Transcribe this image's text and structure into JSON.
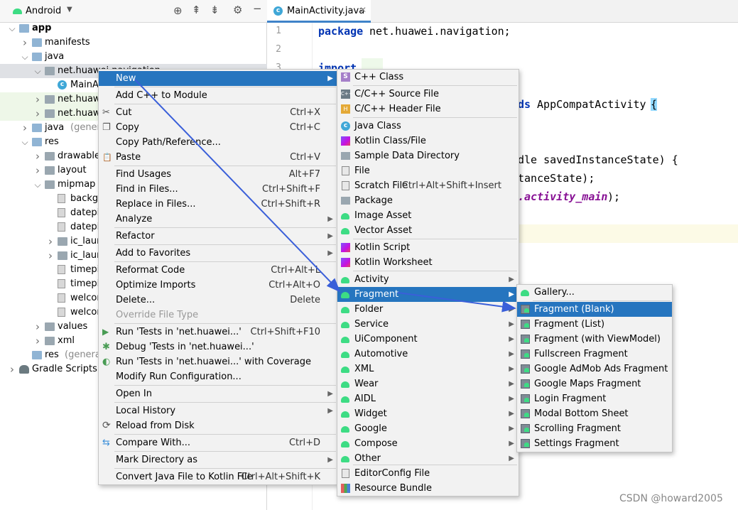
{
  "project_pane": {
    "view_selector": "Android",
    "tree": [
      {
        "label": "app",
        "bold": true
      },
      {
        "label": "manifests"
      },
      {
        "label": "java"
      },
      {
        "label": "net.huawei.navigation"
      },
      {
        "label": "MainA"
      },
      {
        "label": "net.huawe"
      },
      {
        "label": "net.huawe"
      },
      {
        "label": "java",
        "suffix": "(genera"
      },
      {
        "label": "res"
      },
      {
        "label": "drawable"
      },
      {
        "label": "layout"
      },
      {
        "label": "mipmap"
      },
      {
        "label": "backg"
      },
      {
        "label": "datepi"
      },
      {
        "label": "datepi"
      },
      {
        "label": "ic_laun"
      },
      {
        "label": "ic_laun"
      },
      {
        "label": "timepi"
      },
      {
        "label": "timepi"
      },
      {
        "label": "welcor"
      },
      {
        "label": "welcor"
      },
      {
        "label": "values"
      },
      {
        "label": "xml"
      },
      {
        "label": "res",
        "suffix": "(generat"
      },
      {
        "label": "Gradle Scripts"
      }
    ]
  },
  "editor": {
    "tab": "MainActivity.java",
    "line_numbers": [
      "1",
      "2",
      "3"
    ],
    "code": {
      "l1_kw": "package",
      "l1_rest": " net.huawei.navigation;",
      "l3_kw": "import",
      "l5_kw": "ds",
      "l5_rest": " AppCompatActivity ",
      "l5_brace": "{",
      "l8": "dle savedInstanceState) {",
      "l9": "tanceState);",
      "l10_italic": ".activity_main",
      "l10_rest": ");"
    }
  },
  "context_menu": [
    {
      "label": "New",
      "sub": true,
      "selected": true
    },
    {
      "label": "Add C++ to Module"
    },
    {
      "label": "Cut",
      "shortcut": "Ctrl+X",
      "icon": "cut-icon"
    },
    {
      "label": "Copy",
      "shortcut": "Ctrl+C",
      "icon": "copy-icon"
    },
    {
      "label": "Copy Path/Reference..."
    },
    {
      "label": "Paste",
      "shortcut": "Ctrl+V",
      "icon": "paste-icon"
    },
    {
      "label": "Find Usages",
      "shortcut": "Alt+F7"
    },
    {
      "label": "Find in Files...",
      "shortcut": "Ctrl+Shift+F"
    },
    {
      "label": "Replace in Files...",
      "shortcut": "Ctrl+Shift+R"
    },
    {
      "label": "Analyze",
      "sub": true
    },
    {
      "label": "Refactor",
      "sub": true
    },
    {
      "label": "Add to Favorites",
      "sub": true
    },
    {
      "label": "Reformat Code",
      "shortcut": "Ctrl+Alt+L"
    },
    {
      "label": "Optimize Imports",
      "shortcut": "Ctrl+Alt+O"
    },
    {
      "label": "Delete...",
      "shortcut": "Delete"
    },
    {
      "label": "Override File Type",
      "disabled": true
    },
    {
      "label": "Run 'Tests in 'net.huawei...'",
      "shortcut": "Ctrl+Shift+F10",
      "icon": "run-icon"
    },
    {
      "label": "Debug 'Tests in 'net.huawei...'",
      "icon": "debug-icon"
    },
    {
      "label": "Run 'Tests in 'net.huawei...' with Coverage",
      "icon": "coverage-icon"
    },
    {
      "label": "Modify Run Configuration..."
    },
    {
      "label": "Open In",
      "sub": true
    },
    {
      "label": "Local History",
      "sub": true
    },
    {
      "label": "Reload from Disk",
      "icon": "reload-icon"
    },
    {
      "label": "Compare With...",
      "shortcut": "Ctrl+D",
      "icon": "compare-icon"
    },
    {
      "label": "Mark Directory as",
      "sub": true
    },
    {
      "label": "Convert Java File to Kotlin File",
      "shortcut": "Ctrl+Alt+Shift+K"
    }
  ],
  "new_menu": [
    {
      "label": "C++ Class",
      "icon": "cpp-class-icon"
    },
    {
      "label": "C/C++ Source File",
      "icon": "cpp-source-icon"
    },
    {
      "label": "C/C++ Header File",
      "icon": "cpp-header-icon"
    },
    {
      "label": "Java Class",
      "icon": "java-class-icon"
    },
    {
      "label": "Kotlin Class/File",
      "icon": "kotlin-icon"
    },
    {
      "label": "Sample Data Directory",
      "icon": "folder-icon"
    },
    {
      "label": "File",
      "icon": "file-icon"
    },
    {
      "label": "Scratch File",
      "shortcut": "Ctrl+Alt+Shift+Insert",
      "icon": "scratch-icon"
    },
    {
      "label": "Package",
      "icon": "package-icon"
    },
    {
      "label": "Image Asset",
      "icon": "android-icon"
    },
    {
      "label": "Vector Asset",
      "icon": "android-icon"
    },
    {
      "label": "Kotlin Script",
      "icon": "kotlin-script-icon"
    },
    {
      "label": "Kotlin Worksheet",
      "icon": "kotlin-worksheet-icon"
    },
    {
      "label": "Activity",
      "sub": true,
      "icon": "android-icon"
    },
    {
      "label": "Fragment",
      "sub": true,
      "selected": true,
      "icon": "android-icon"
    },
    {
      "label": "Folder",
      "sub": true,
      "icon": "android-icon"
    },
    {
      "label": "Service",
      "sub": true,
      "icon": "android-icon"
    },
    {
      "label": "UiComponent",
      "sub": true,
      "icon": "android-icon"
    },
    {
      "label": "Automotive",
      "sub": true,
      "icon": "android-icon"
    },
    {
      "label": "XML",
      "sub": true,
      "icon": "android-icon"
    },
    {
      "label": "Wear",
      "sub": true,
      "icon": "android-icon"
    },
    {
      "label": "AIDL",
      "sub": true,
      "icon": "android-icon"
    },
    {
      "label": "Widget",
      "sub": true,
      "icon": "android-icon"
    },
    {
      "label": "Google",
      "sub": true,
      "icon": "android-icon"
    },
    {
      "label": "Compose",
      "sub": true,
      "icon": "android-icon"
    },
    {
      "label": "Other",
      "sub": true,
      "icon": "android-icon"
    },
    {
      "label": "EditorConfig File",
      "icon": "editorconfig-icon"
    },
    {
      "label": "Resource Bundle",
      "icon": "resource-bundle-icon"
    }
  ],
  "fragment_menu": [
    {
      "label": "Gallery...",
      "icon": "android-icon"
    },
    {
      "label": "Fragment (Blank)",
      "selected": true,
      "icon": "fragment-icon"
    },
    {
      "label": "Fragment (List)",
      "icon": "fragment-icon"
    },
    {
      "label": "Fragment (with ViewModel)",
      "icon": "fragment-icon"
    },
    {
      "label": "Fullscreen Fragment",
      "icon": "fragment-icon"
    },
    {
      "label": "Google AdMob Ads Fragment",
      "icon": "fragment-icon"
    },
    {
      "label": "Google Maps Fragment",
      "icon": "fragment-icon"
    },
    {
      "label": "Login Fragment",
      "icon": "fragment-icon"
    },
    {
      "label": "Modal Bottom Sheet",
      "icon": "fragment-icon"
    },
    {
      "label": "Scrolling Fragment",
      "icon": "fragment-icon"
    },
    {
      "label": "Settings Fragment",
      "icon": "fragment-icon"
    }
  ],
  "watermark": "CSDN @howard2005",
  "colors": {
    "selection": "#2675bf",
    "annotation_arrow": "#3a5fd9",
    "menu_bg": "#f2f2f2"
  }
}
